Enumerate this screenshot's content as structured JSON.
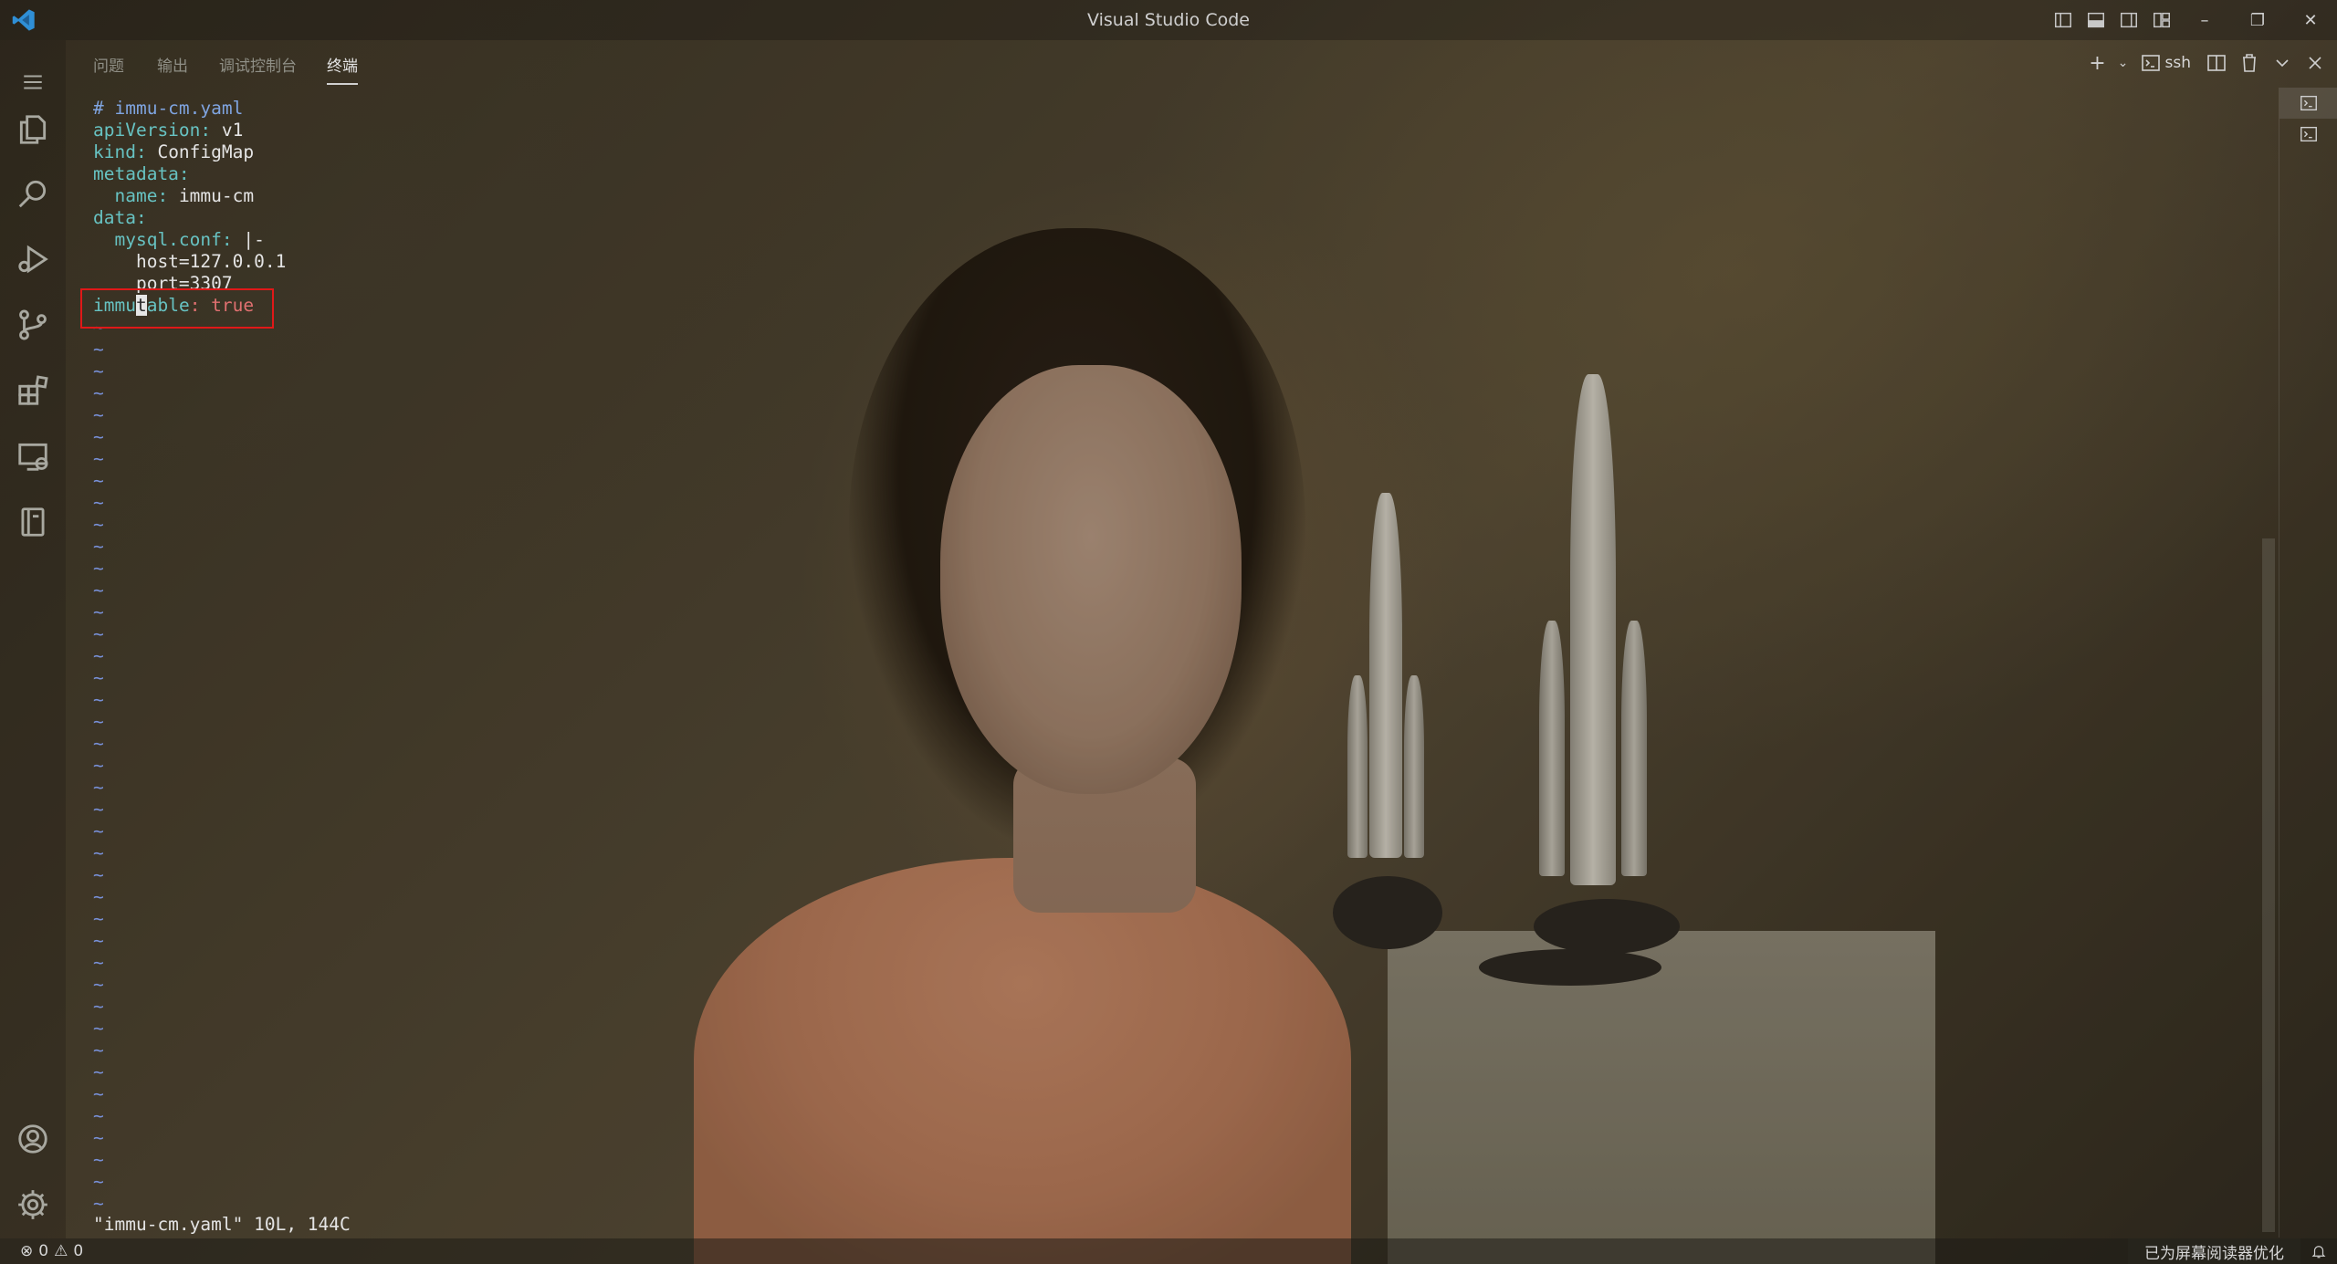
{
  "window": {
    "title": "Visual Studio Code"
  },
  "panel": {
    "tabs": [
      {
        "label": "问题"
      },
      {
        "label": "输出"
      },
      {
        "label": "调试控制台"
      },
      {
        "label": "终端",
        "active": true
      }
    ],
    "terminal_name": "ssh",
    "terminal_count": 2
  },
  "terminal": {
    "lines": [
      {
        "parts": [
          {
            "t": "# immu-cm.yaml",
            "c": "comment"
          }
        ]
      },
      {
        "parts": [
          {
            "t": "apiVersion",
            "c": "key"
          },
          {
            "t": ": ",
            "c": "key"
          },
          {
            "t": "v1",
            "c": "val"
          }
        ]
      },
      {
        "parts": [
          {
            "t": "kind",
            "c": "key"
          },
          {
            "t": ": ",
            "c": "key"
          },
          {
            "t": "ConfigMap",
            "c": "val"
          }
        ]
      },
      {
        "parts": [
          {
            "t": "metadata",
            "c": "key"
          },
          {
            "t": ":",
            "c": "key"
          }
        ]
      },
      {
        "parts": [
          {
            "t": "  name",
            "c": "key"
          },
          {
            "t": ": ",
            "c": "key"
          },
          {
            "t": "immu-cm",
            "c": "val"
          }
        ]
      },
      {
        "parts": [
          {
            "t": "data",
            "c": "key"
          },
          {
            "t": ":",
            "c": "key"
          }
        ]
      },
      {
        "parts": [
          {
            "t": "  mysql.conf",
            "c": "key"
          },
          {
            "t": ": ",
            "c": "key"
          },
          {
            "t": "|-",
            "c": "val"
          }
        ]
      },
      {
        "parts": [
          {
            "t": "    host=127.0.0.1",
            "c": "val"
          }
        ]
      },
      {
        "parts": [
          {
            "t": "    port=3307",
            "c": "val"
          }
        ]
      }
    ],
    "edited_line": {
      "before_cursor": "immu",
      "cursor_char": "t",
      "after_cursor": "able",
      "colon": ": ",
      "value": "true"
    },
    "tilde_count": 41,
    "tilde": "~",
    "status_message": "\"immu-cm.yaml\" 10L, 144C"
  },
  "statusbar": {
    "errors": "0",
    "warnings": "0",
    "accessibility": "已为屏幕阅读器优化"
  },
  "colors": {
    "highlight_box": "#e01818",
    "comment": "#7fa4e0",
    "key": "#67c2c2",
    "tilde": "#7890d8"
  }
}
